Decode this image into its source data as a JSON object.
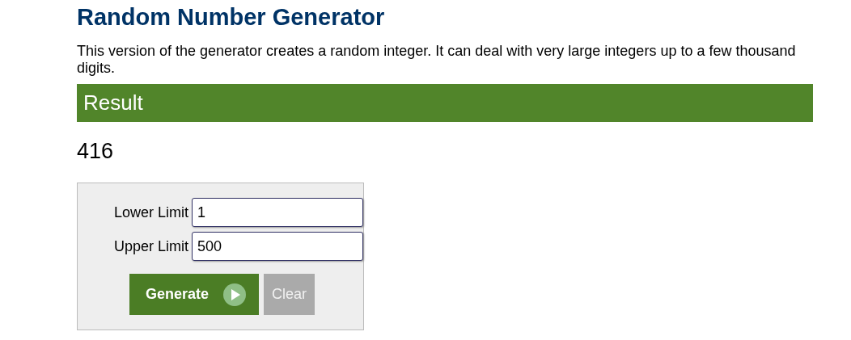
{
  "title": "Random Number Generator",
  "description": "This version of the generator creates a random integer. It can deal with very large integers up to a few thousand digits.",
  "result_header": "Result",
  "result_value": "416",
  "fields": [
    {
      "label": "Lower Limit",
      "value": "1"
    },
    {
      "label": "Upper Limit",
      "value": "500"
    }
  ],
  "buttons": [
    {
      "label": "Generate",
      "kind": "primary"
    },
    {
      "label": "Clear",
      "kind": "secondary"
    }
  ]
}
